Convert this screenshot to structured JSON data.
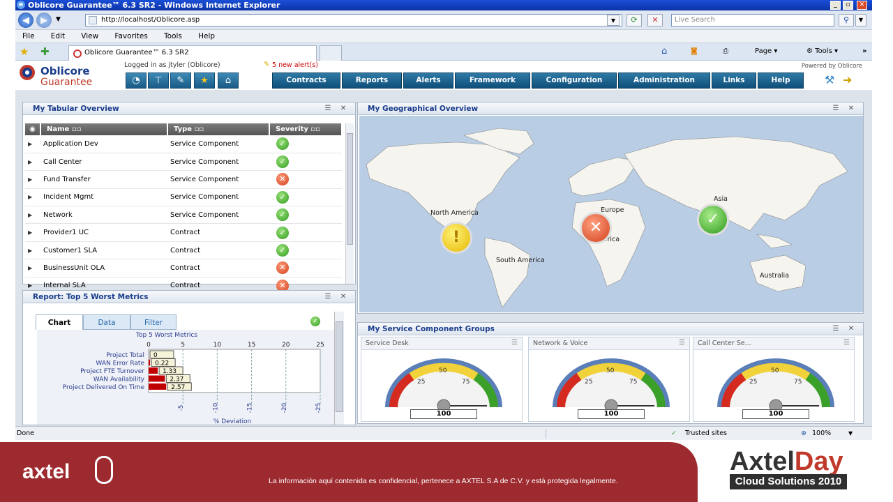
{
  "window": {
    "title": "Oblicore Guarantee™ 6.3 SR2 - Windows Internet Explorer",
    "buttons": [
      "_",
      "▫",
      "✕"
    ]
  },
  "browser": {
    "url": "http://localhost/Oblicore.asp",
    "search_placeholder": "Live Search",
    "menu": [
      "File",
      "Edit",
      "View",
      "Favorites",
      "Tools",
      "Help"
    ],
    "tab_title": "Oblicore Guarantee™ 6.3 SR2",
    "page_menu": "Page",
    "tools_menu": "Tools",
    "chevron": "»"
  },
  "app": {
    "logo_line1": "Oblicore",
    "logo_line2": "Guarantee",
    "logged_in": "Logged in as jtyler (Oblicore)",
    "alerts": "5 new alert(s)",
    "powered_by": "Powered by Oblicore",
    "nav": [
      "Contracts",
      "Reports",
      "Alerts",
      "Framework",
      "Configuration",
      "Administration",
      "Links",
      "Help"
    ]
  },
  "tabular": {
    "title": "My Tabular Overview",
    "columns": [
      "Name",
      "Type",
      "Severity"
    ],
    "rows": [
      {
        "name": "Application Dev",
        "type": "Service Component",
        "severity": "ok"
      },
      {
        "name": "Call Center",
        "type": "Service Component",
        "severity": "ok"
      },
      {
        "name": "Fund Transfer",
        "type": "Service Component",
        "severity": "bad"
      },
      {
        "name": "Incident Mgmt",
        "type": "Service Component",
        "severity": "ok"
      },
      {
        "name": "Network",
        "type": "Service Component",
        "severity": "ok"
      },
      {
        "name": "Provider1 UC",
        "type": "Contract",
        "severity": "ok"
      },
      {
        "name": "Customer1 SLA",
        "type": "Contract",
        "severity": "ok"
      },
      {
        "name": "BusinessUnit OLA",
        "type": "Contract",
        "severity": "bad"
      },
      {
        "name": "Internal SLA",
        "type": "Contract",
        "severity": "bad"
      }
    ]
  },
  "geo": {
    "title": "My Geographical Overview",
    "labels": {
      "na": "North America",
      "sa": "South America",
      "eu": "Europe",
      "af": "Africa",
      "as": "Asia",
      "au": "Australia"
    }
  },
  "report": {
    "title": "Report: Top 5 Worst Metrics",
    "tabs": [
      "Chart",
      "Data",
      "Filter"
    ]
  },
  "chart_data": {
    "type": "bar",
    "title": "Top 5 Worst Metrics",
    "xlabel": "% Deviation",
    "categories": [
      "Project Total",
      "WAN Error Rate",
      "Project FTE Turnover",
      "WAN Availability",
      "Project Delivered On Time"
    ],
    "values": [
      0,
      0.22,
      1.33,
      2.37,
      2.57
    ],
    "value_labels": [
      "0",
      "0.22",
      "1.33",
      "2.37",
      "2.57"
    ],
    "top_ticks": [
      "0",
      "5",
      "10",
      "15",
      "20",
      "25"
    ],
    "bottom_ticks": [
      "-5",
      "-10",
      "-15",
      "-20",
      "-25"
    ],
    "xlim": [
      0,
      25
    ],
    "bar_color": "#c00000"
  },
  "groups": {
    "title": "My Service Component Groups",
    "panels": [
      {
        "title": "Service Desk",
        "value": "100"
      },
      {
        "title": "Network & Voice",
        "value": "100"
      },
      {
        "title": "Call Center Se...",
        "value": "100"
      }
    ],
    "gauge_ticks": [
      "25",
      "50",
      "75"
    ]
  },
  "status": {
    "left": "Done",
    "zone": "Trusted sites",
    "zoom": "100%"
  },
  "footer": {
    "brand": "axtel",
    "disclaimer": "La información aquí contenida es confidencial, pertenece a AXTEL S.A de C.V. y está protegida legalmente.",
    "event_line1a": "Axtel",
    "event_line1b": "Day",
    "event_line2": "Cloud Solutions 2010"
  }
}
